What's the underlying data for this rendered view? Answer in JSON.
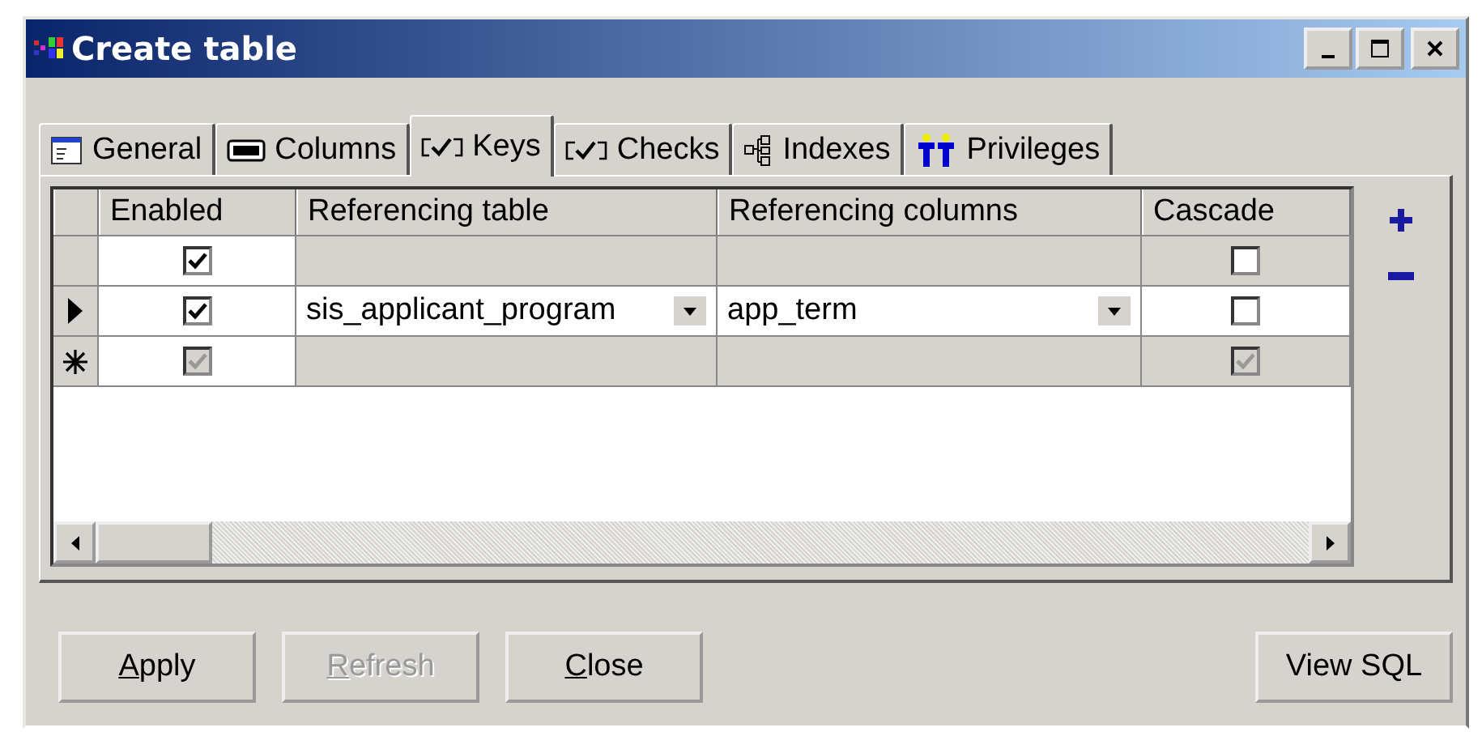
{
  "window": {
    "title": "Create table"
  },
  "tabs": [
    {
      "label": "General",
      "selected": false
    },
    {
      "label": "Columns",
      "selected": false
    },
    {
      "label": "Keys",
      "selected": true
    },
    {
      "label": "Checks",
      "selected": false
    },
    {
      "label": "Indexes",
      "selected": false
    },
    {
      "label": "Privileges",
      "selected": false
    }
  ],
  "grid": {
    "columns": [
      "Enabled",
      "Referencing table",
      "Referencing columns",
      "Cascade"
    ],
    "rows": [
      {
        "kind": "plain",
        "selected": false,
        "enabled": true,
        "enabled_disabled": false,
        "cascade": false,
        "cascade_disabled": false
      },
      {
        "kind": "current",
        "selected": true,
        "enabled": true,
        "enabled_disabled": false,
        "referencing_table": "sis_applicant_program",
        "referencing_columns": "app_term",
        "cascade": false,
        "cascade_disabled": false
      },
      {
        "kind": "new",
        "selected": false,
        "enabled": true,
        "enabled_disabled": true,
        "cascade": true,
        "cascade_disabled": true
      }
    ]
  },
  "buttons": [
    {
      "label": "Apply",
      "disabled": false
    },
    {
      "label": "Refresh",
      "disabled": true
    },
    {
      "label": "Close",
      "disabled": false
    }
  ],
  "view_sql_button": {
    "label": "View SQL"
  }
}
